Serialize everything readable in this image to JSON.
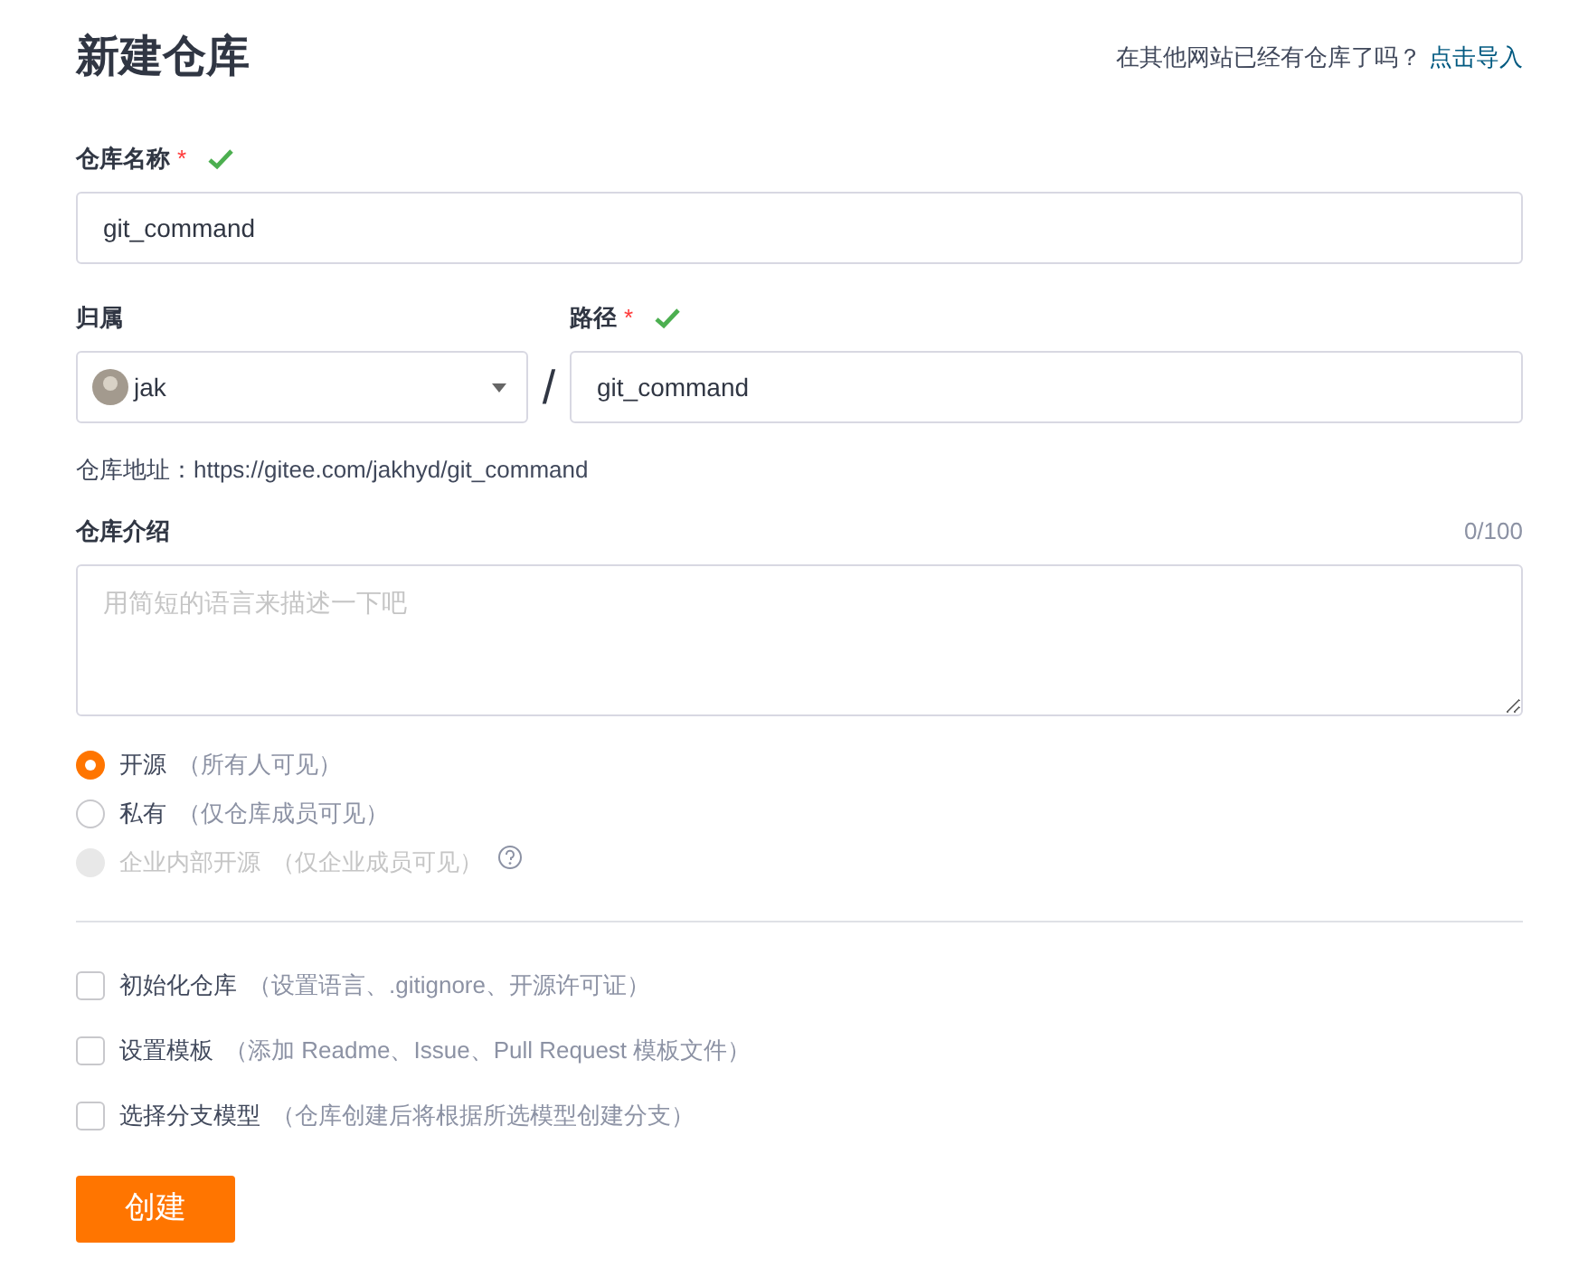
{
  "page": {
    "title": "新建仓库",
    "import_prompt": "在其他网站已经有仓库了吗？",
    "import_link": "点击导入"
  },
  "name_field": {
    "label": "仓库名称",
    "required": "*",
    "valid": true,
    "value": "git_command"
  },
  "owner_field": {
    "label": "归属",
    "value": "jak"
  },
  "separator": "/",
  "path_field": {
    "label": "路径",
    "required": "*",
    "valid": true,
    "value": "git_command"
  },
  "address": {
    "label": "仓库地址：",
    "value": "https://gitee.com/jakhyd/git_command"
  },
  "description": {
    "label": "仓库介绍",
    "counter": "0/100",
    "placeholder": "用简短的语言来描述一下吧"
  },
  "visibility": [
    {
      "label": "开源",
      "hint": "（所有人可见）",
      "selected": true,
      "disabled": false,
      "help": false
    },
    {
      "label": "私有",
      "hint": "（仅仓库成员可见）",
      "selected": false,
      "disabled": false,
      "help": false
    },
    {
      "label": "企业内部开源",
      "hint": "（仅企业成员可见）",
      "selected": false,
      "disabled": true,
      "help": true
    }
  ],
  "options": [
    {
      "label": "初始化仓库",
      "hint": "（设置语言、.gitignore、开源许可证）",
      "checked": false
    },
    {
      "label": "设置模板",
      "hint": "（添加 Readme、Issue、Pull Request 模板文件）",
      "checked": false
    },
    {
      "label": "选择分支模型",
      "hint": "（仓库创建后将根据所选模型创建分支）",
      "checked": false
    }
  ],
  "submit": "创建"
}
